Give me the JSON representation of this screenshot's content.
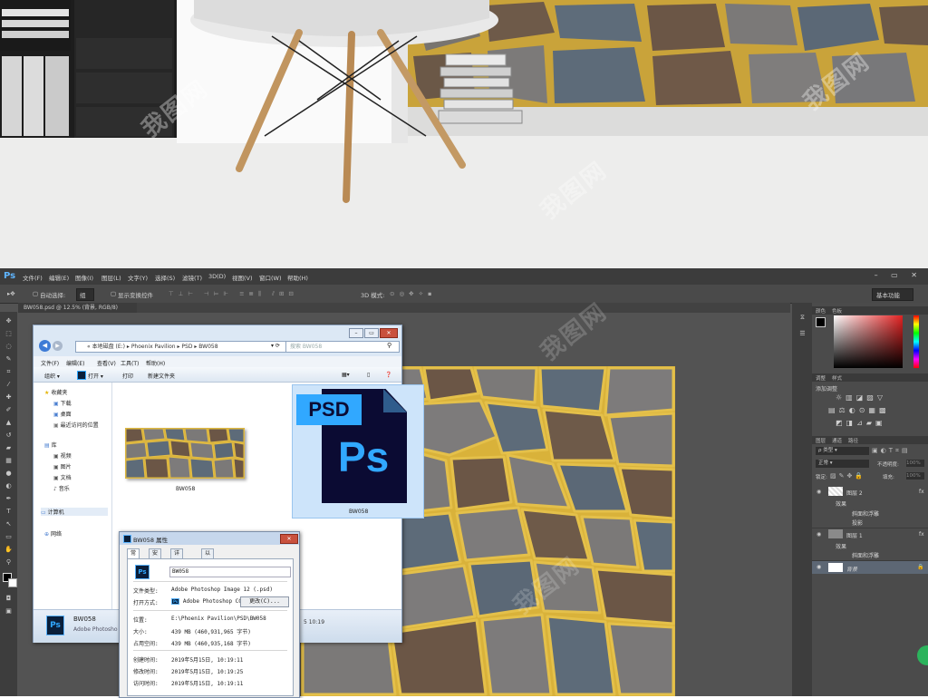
{
  "photoshop": {
    "logo": "Ps",
    "menu": [
      "文件(F)",
      "编辑(E)",
      "图像(I)",
      "图层(L)",
      "文字(Y)",
      "选择(S)",
      "滤镜(T)",
      "3D(D)",
      "视图(V)",
      "窗口(W)",
      "帮助(H)"
    ],
    "options": {
      "auto_select": "自动选择:",
      "auto_select_value": "组",
      "show_transform": "显示变换控件",
      "mode_3d": "3D 模式:",
      "workspace": "基本功能"
    },
    "doc_tab": "BW058.psd @ 12.5% (背景, RGB/8)",
    "panels": {
      "color_tabs": [
        "颜色",
        "色板"
      ],
      "adjust_tabs": [
        "调整",
        "样式"
      ],
      "adjust_label": "添加调整",
      "layers_tabs": [
        "图层",
        "通道",
        "路径"
      ],
      "kind": "类型",
      "blend": "正常",
      "opacity_label": "不透明度:",
      "opacity": "100%",
      "lock_label": "锁定:",
      "fill_label": "填充:",
      "fill": "100%",
      "layers": [
        {
          "name": "图层 2",
          "effects_label": "效果",
          "effects": [
            "斜面和浮雕",
            "投影"
          ]
        },
        {
          "name": "图层 1",
          "effects_label": "效果",
          "effects": [
            "斜面和浮雕"
          ]
        },
        {
          "name": "背景",
          "effects_label": "",
          "effects": []
        }
      ]
    }
  },
  "explorer": {
    "path": [
      "本地磁盘 (E:)",
      "Phoenix Pavilion",
      "PSD",
      "BW058"
    ],
    "search_placeholder": "搜索 BW058",
    "menu": [
      "文件(F)",
      "编辑(E)",
      "查看(V)",
      "工具(T)",
      "帮助(H)"
    ],
    "commands": [
      "组织 ▾",
      "打开 ▾",
      "打印",
      "新建文件夹"
    ],
    "nav": {
      "favorites": "收藏夹",
      "favorites_items": [
        "下载",
        "桌面",
        "最近访问的位置"
      ],
      "libraries": "库",
      "libraries_items": [
        "视频",
        "图片",
        "文档",
        "音乐"
      ],
      "computer": "计算机",
      "network": "网络"
    },
    "files": [
      {
        "name": "BW058",
        "type": "jpg"
      },
      {
        "name": "BW058",
        "type": "psd",
        "badge": "PSD",
        "icon_text": "Ps"
      }
    ],
    "status": {
      "name": "BW058",
      "app": "Adobe Photosho",
      "date": "5 10:19"
    }
  },
  "properties": {
    "title": "BW058 属性",
    "tabs": [
      "常规",
      "安全",
      "详细信息",
      "以前的版本"
    ],
    "filename": "BW058",
    "rows": [
      {
        "label": "文件类型:",
        "value": "Adobe Photoshop Image 12 (.psd)"
      },
      {
        "label": "打开方式:",
        "value": "Adobe Photoshop CC",
        "button": "更改(C)..."
      },
      {
        "label": "位置:",
        "value": "E:\\Phoenix Pavilion\\PSD\\BW058"
      },
      {
        "label": "大小:",
        "value": "439 MB (460,931,965 字节)"
      },
      {
        "label": "占用空间:",
        "value": "439 MB (460,935,168 字节)"
      },
      {
        "label": "创建时间:",
        "value": "2019年5月15日, 10:19:11"
      },
      {
        "label": "修改时间:",
        "value": "2019年5月15日, 10:19:25"
      },
      {
        "label": "访问时间:",
        "value": "2019年5月15日, 10:19:11"
      }
    ]
  },
  "watermark_text": "我图网",
  "colors": {
    "ps_bg": "#535353",
    "ps_panel": "#4b4b4b",
    "accent": "#31a8ff",
    "tile_gray": "#7d7b7b",
    "tile_blue": "#5d6b79",
    "tile_brown": "#6b5646",
    "grout_gold": "#d9b23a"
  }
}
